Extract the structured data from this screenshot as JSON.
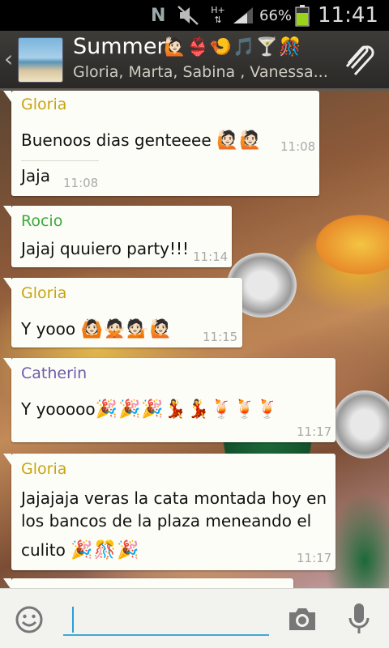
{
  "status_bar": {
    "network_letter": "N",
    "network_type": "H+",
    "battery_percent": "66%",
    "time": "11:41",
    "icons": [
      "notification-n-icon",
      "mute-icon",
      "data-arrows-icon",
      "signal-icon",
      "battery-icon"
    ]
  },
  "header": {
    "title": "Summer",
    "title_emojis": "🙋🏻👙🍤🎵🍸🎊",
    "members": "Gloria, Marta, Sabina , Vanessa...",
    "icons": [
      "back-chevron-icon",
      "paperclip-icon"
    ]
  },
  "messages": [
    {
      "sender": "Gloria",
      "sender_color": "#c9a313",
      "text": "Buenoos dias genteeee",
      "emojis": "🙋🏻🙋🏻",
      "time": "11:08",
      "text2": "Jaja",
      "time2": "11:08"
    },
    {
      "sender": "Rocio",
      "sender_color": "#3aa93a",
      "text": "Jajaj quuiero party!!!",
      "time": "11:14"
    },
    {
      "sender": "Gloria",
      "sender_color": "#c9a313",
      "text": "Y yooo",
      "emojis": "🙆🏻🙅🏻💁🏻🙋🏻",
      "time": "11:15"
    },
    {
      "sender": "Catherin",
      "sender_color": "#6e5cab",
      "text": "Y yooooo",
      "emojis": "🎉🎉🎉💃💃🍹🍹🍹",
      "time": "11:17"
    },
    {
      "sender": "Gloria",
      "sender_color": "#c9a313",
      "line1": "Jajajaja veras la cata montada hoy en",
      "line2": "los bancos de la plaza meneando el",
      "line3": "culito",
      "emojis": "🎉🎊🎉",
      "time": "11:17"
    }
  ],
  "input_bar": {
    "placeholder": "",
    "icons": [
      "emoji-smiley-icon",
      "camera-icon",
      "microphone-icon"
    ]
  }
}
